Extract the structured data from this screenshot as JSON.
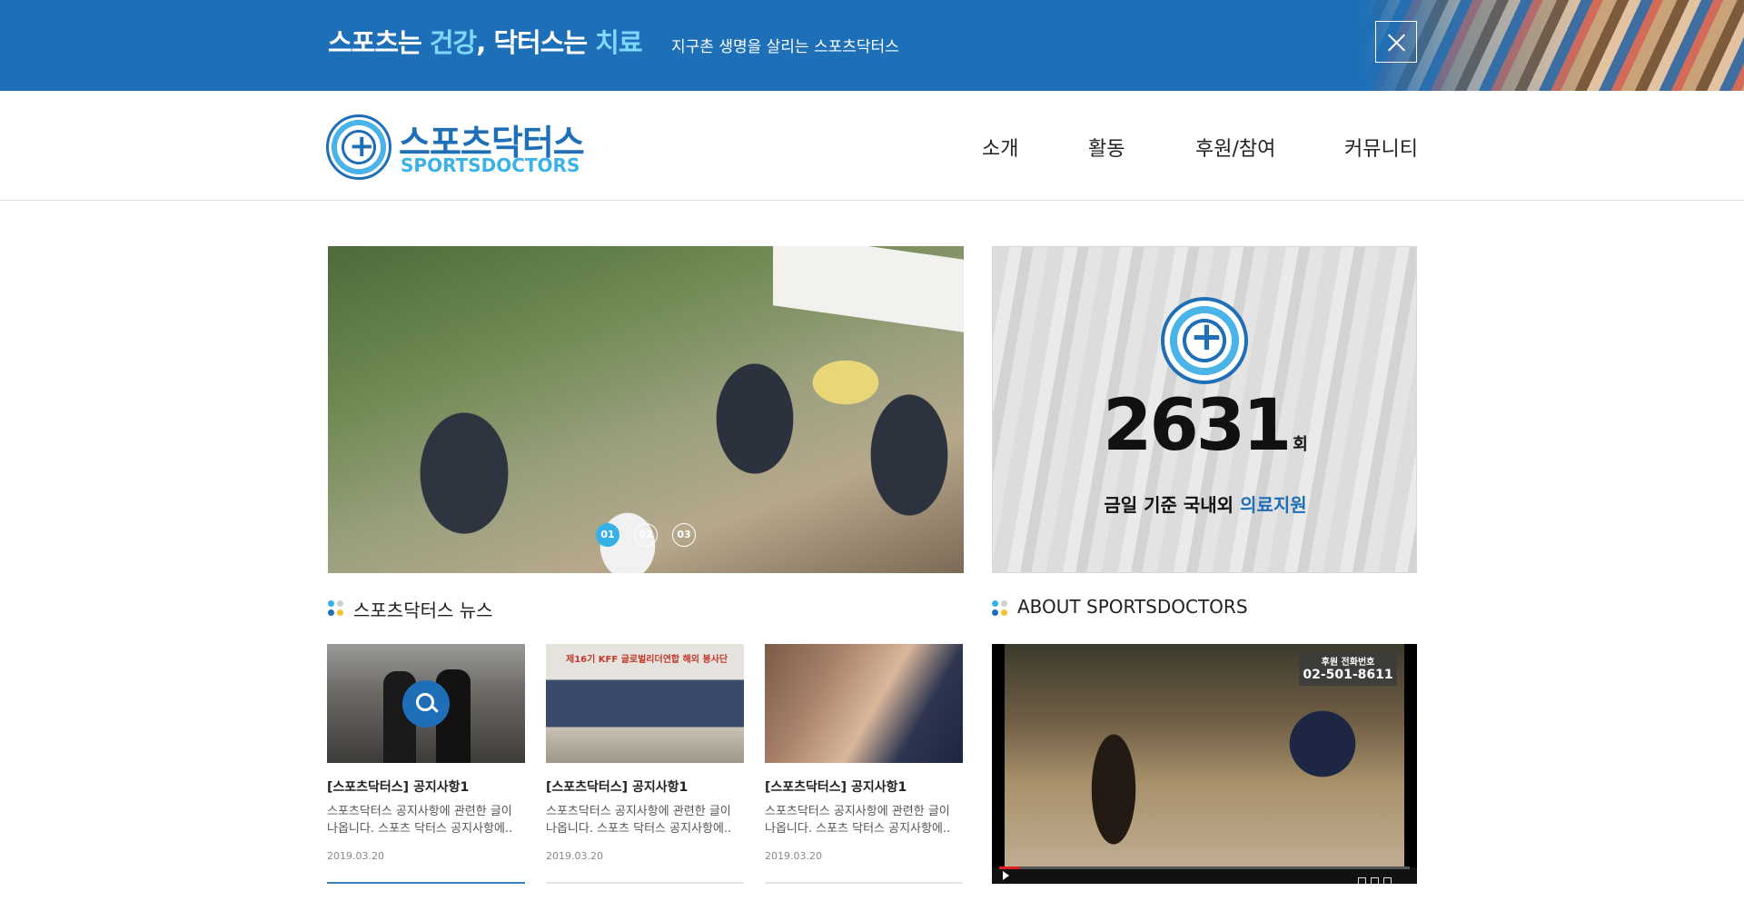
{
  "banner": {
    "slogan_part1": "스포츠는 ",
    "slogan_highlight1": "건강",
    "slogan_part2": ", 닥터스는 ",
    "slogan_highlight2": "치료",
    "subtitle": "지구촌 생명을 살리는 스포츠닥터스",
    "close_icon": "close-icon"
  },
  "header": {
    "logo_korean": "스포츠닥터스",
    "logo_english": "SPORTSDOCTORS",
    "nav": [
      "소개",
      "활동",
      "후원/참여",
      "커뮤니티"
    ]
  },
  "slider": {
    "dots": [
      "01",
      "02",
      "03"
    ],
    "active_index": 0
  },
  "stats": {
    "count": "2631",
    "unit": "회",
    "label_part1": "금일 기준 국내외 ",
    "label_highlight": "의료지원"
  },
  "news": {
    "title": "스포츠닥터스 뉴스",
    "items": [
      {
        "title": "[스포츠닥터스] 공지사항1",
        "desc": "스포츠닥터스 공지사항에 관련한 글이 나옵니다. 스포츠 닥터스 공지사항에..",
        "date": "2019.03.20"
      },
      {
        "title": "[스포츠닥터스] 공지사항1",
        "desc": "스포츠닥터스 공지사항에 관련한 글이 나옵니다. 스포츠 닥터스 공지사항에..",
        "date": "2019.03.20"
      },
      {
        "title": "[스포츠닥터스] 공지사항1",
        "desc": "스포츠닥터스 공지사항에 관련한 글이 나옵니다. 스포츠 닥터스 공지사항에..",
        "date": "2019.03.20"
      }
    ]
  },
  "about": {
    "title": "ABOUT SPORTSDOCTORS",
    "video_overlay_label": "후원 전화번호",
    "video_overlay_phone": "02-501-8611",
    "video_progress": 0.05
  },
  "colors": {
    "brand_blue": "#1f6fb8",
    "accent_cyan": "#35b1e6",
    "banner_bg": "#1d6fb8"
  }
}
